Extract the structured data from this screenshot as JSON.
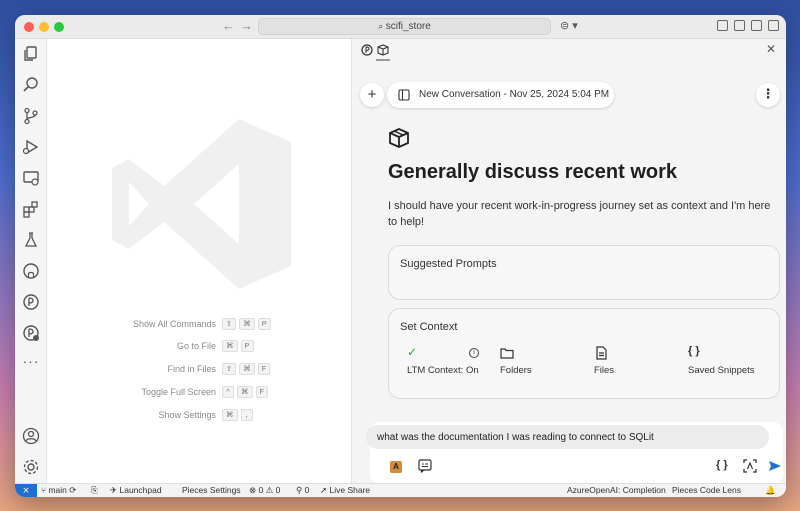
{
  "titlebar": {
    "search_text": "scifi_store"
  },
  "activity_bar": {
    "items": [
      "explorer-icon",
      "search-icon",
      "source-control-icon",
      "run-debug-icon",
      "remote-explorer-icon",
      "extensions-icon",
      "testing-icon",
      "github-icon",
      "pieces-icon",
      "pieces-copilot-icon",
      "more-icon",
      "account-icon",
      "settings-icon"
    ]
  },
  "editor": {
    "shortcuts": [
      {
        "label": "Show All Commands",
        "keys": [
          "⇧",
          "⌘",
          "P"
        ]
      },
      {
        "label": "Go to File",
        "keys": [
          "⌘",
          "P"
        ]
      },
      {
        "label": "Find in Files",
        "keys": [
          "⇧",
          "⌘",
          "F"
        ]
      },
      {
        "label": "Toggle Full Screen",
        "keys": [
          "^",
          "⌘",
          "F"
        ]
      },
      {
        "label": "Show Settings",
        "keys": [
          "⌘",
          ","
        ]
      }
    ]
  },
  "chat": {
    "new_button": "+",
    "conversation_title": "New Conversation - Nov 25, 2024 5:04 PM",
    "more_button": "⋮",
    "heading": "Generally discuss recent work",
    "description": "I should have your recent work-in-progress journey set as context and I'm here to help!",
    "suggested_prompts_title": "Suggested Prompts",
    "set_context_title": "Set Context",
    "context_items": [
      {
        "label": "LTM Context: On",
        "icon": "check-icon"
      },
      {
        "label": "Folders",
        "icon": "folder-icon"
      },
      {
        "label": "Files",
        "icon": "file-icon"
      },
      {
        "label": "Saved Snippets",
        "icon": "snippet-icon"
      }
    ],
    "input_value": "what was the documentation I was reading to connect to SQLit"
  },
  "statusbar": {
    "remote": "⨯",
    "branch": "main",
    "launchpad": "Launchpad",
    "pieces_settings": "Pieces Settings",
    "errors": "0",
    "warnings": "0",
    "ports": "0",
    "live_share": "Live Share",
    "model": "AzureOpenAI: Completion",
    "code_lens": "Pieces Code Lens"
  },
  "colors": {
    "accent": "#1f6fd1",
    "check_green": "#2ea043"
  }
}
